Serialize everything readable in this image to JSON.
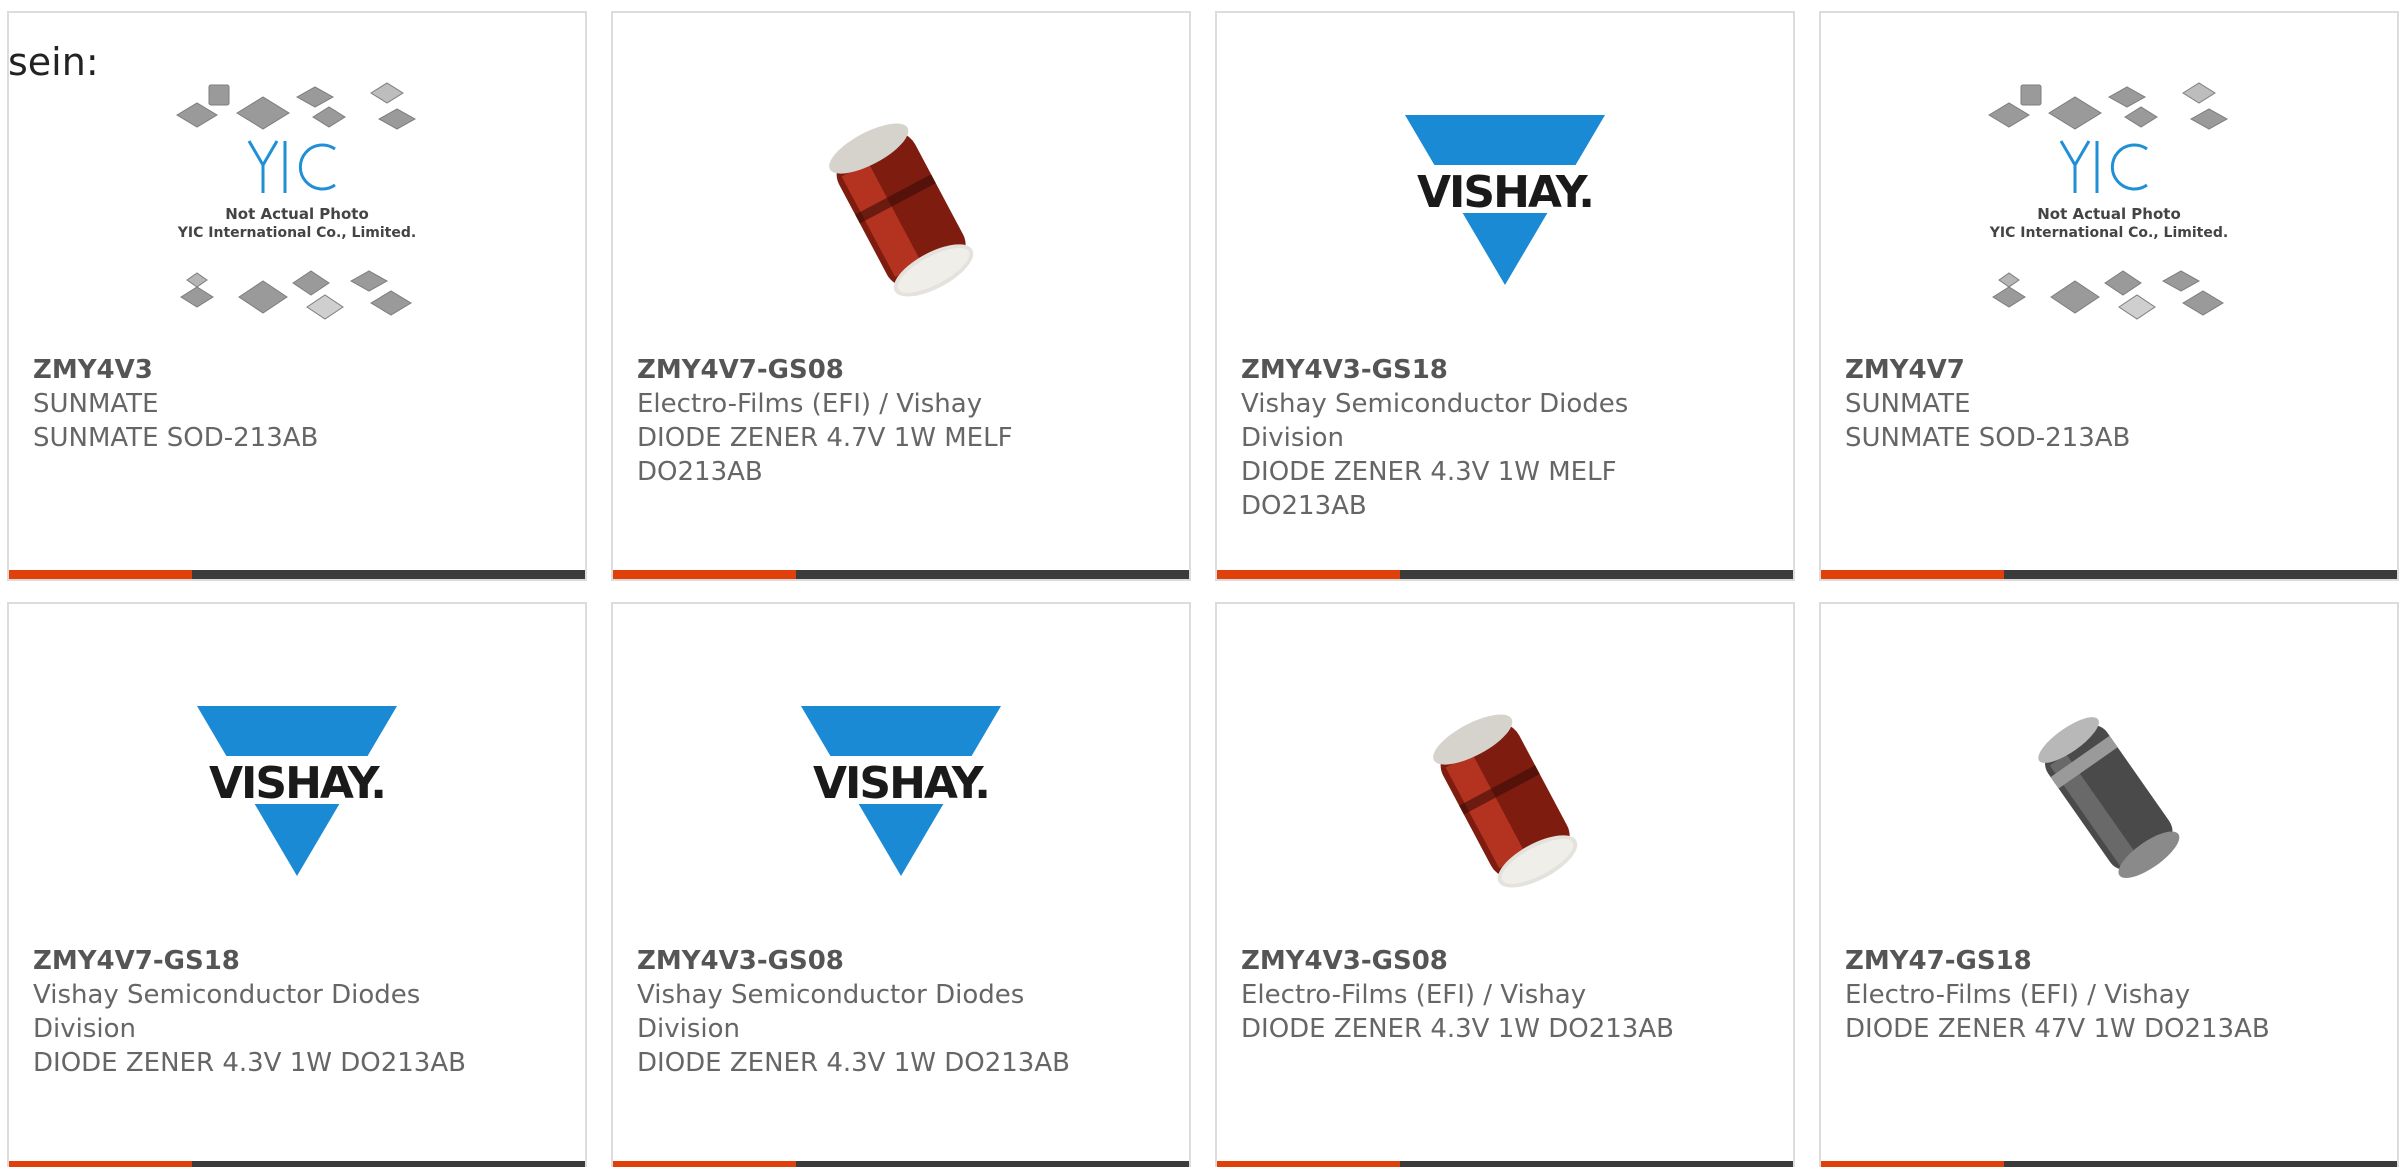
{
  "heading": "sein:",
  "products": [
    {
      "part": "ZMY4V3",
      "maker": "SUNMATE",
      "desc": "SUNMATE SOD-213AB",
      "image": "yic-placeholder",
      "placeholder_line1": "Not Actual Photo",
      "placeholder_line2": "YIC International Co., Limited."
    },
    {
      "part": "ZMY4V7-GS08",
      "maker": "Electro-Films (EFI) / Vishay",
      "desc": "DIODE ZENER 4.7V 1W MELF DO213AB",
      "image": "red-melf-diode"
    },
    {
      "part": "ZMY4V3-GS18",
      "maker": "Vishay Semiconductor Diodes Division",
      "desc": "DIODE ZENER 4.3V 1W MELF DO213AB",
      "image": "vishay-logo",
      "logo_text": "VISHAY."
    },
    {
      "part": "ZMY4V7",
      "maker": "SUNMATE",
      "desc": "SUNMATE SOD-213AB",
      "image": "yic-placeholder",
      "placeholder_line1": "Not Actual Photo",
      "placeholder_line2": "YIC International Co., Limited."
    },
    {
      "part": "ZMY4V7-GS18",
      "maker": "Vishay Semiconductor Diodes Division",
      "desc": "DIODE ZENER 4.3V 1W DO213AB",
      "image": "vishay-logo",
      "logo_text": "VISHAY."
    },
    {
      "part": "ZMY4V3-GS08",
      "maker": "Vishay Semiconductor Diodes Division",
      "desc": "DIODE ZENER 4.3V 1W DO213AB",
      "image": "vishay-logo",
      "logo_text": "VISHAY."
    },
    {
      "part": "ZMY4V3-GS08",
      "maker": "Electro-Films (EFI) / Vishay",
      "desc": "DIODE ZENER 4.3V 1W DO213AB",
      "image": "red-melf-diode"
    },
    {
      "part": "ZMY47-GS18",
      "maker": "Electro-Films (EFI) / Vishay",
      "desc": "DIODE ZENER 47V 1W DO213AB",
      "image": "black-melf-diode"
    }
  ],
  "colors": {
    "accent": "#e0410b",
    "bar": "#3b3b3b",
    "vishay_blue": "#1a8ad4",
    "yic_blue": "#1f8fd6"
  }
}
